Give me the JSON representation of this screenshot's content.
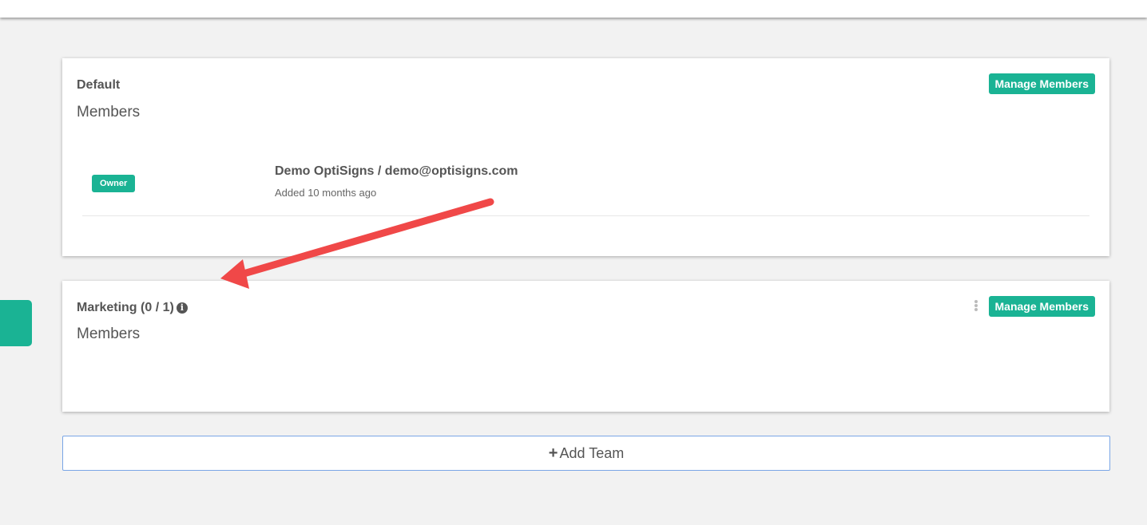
{
  "teams": [
    {
      "name": "Default",
      "members_label": "Members",
      "manage_label": "Manage Members",
      "members": [
        {
          "role": "Owner",
          "name": "Demo OptiSigns / demo@optisigns.com",
          "added": "Added 10 months ago"
        }
      ]
    },
    {
      "name": "Marketing (0 / 1)",
      "members_label": "Members",
      "manage_label": "Manage Members",
      "info_glyph": "i"
    }
  ],
  "add_team": {
    "label": "Add Team",
    "icon": "plus-icon",
    "icon_glyph": "+"
  },
  "colors": {
    "accent": "#1ab394",
    "arrow": "#f04848",
    "background": "#f2f2f2",
    "add_team_border": "#7aa6e6"
  }
}
